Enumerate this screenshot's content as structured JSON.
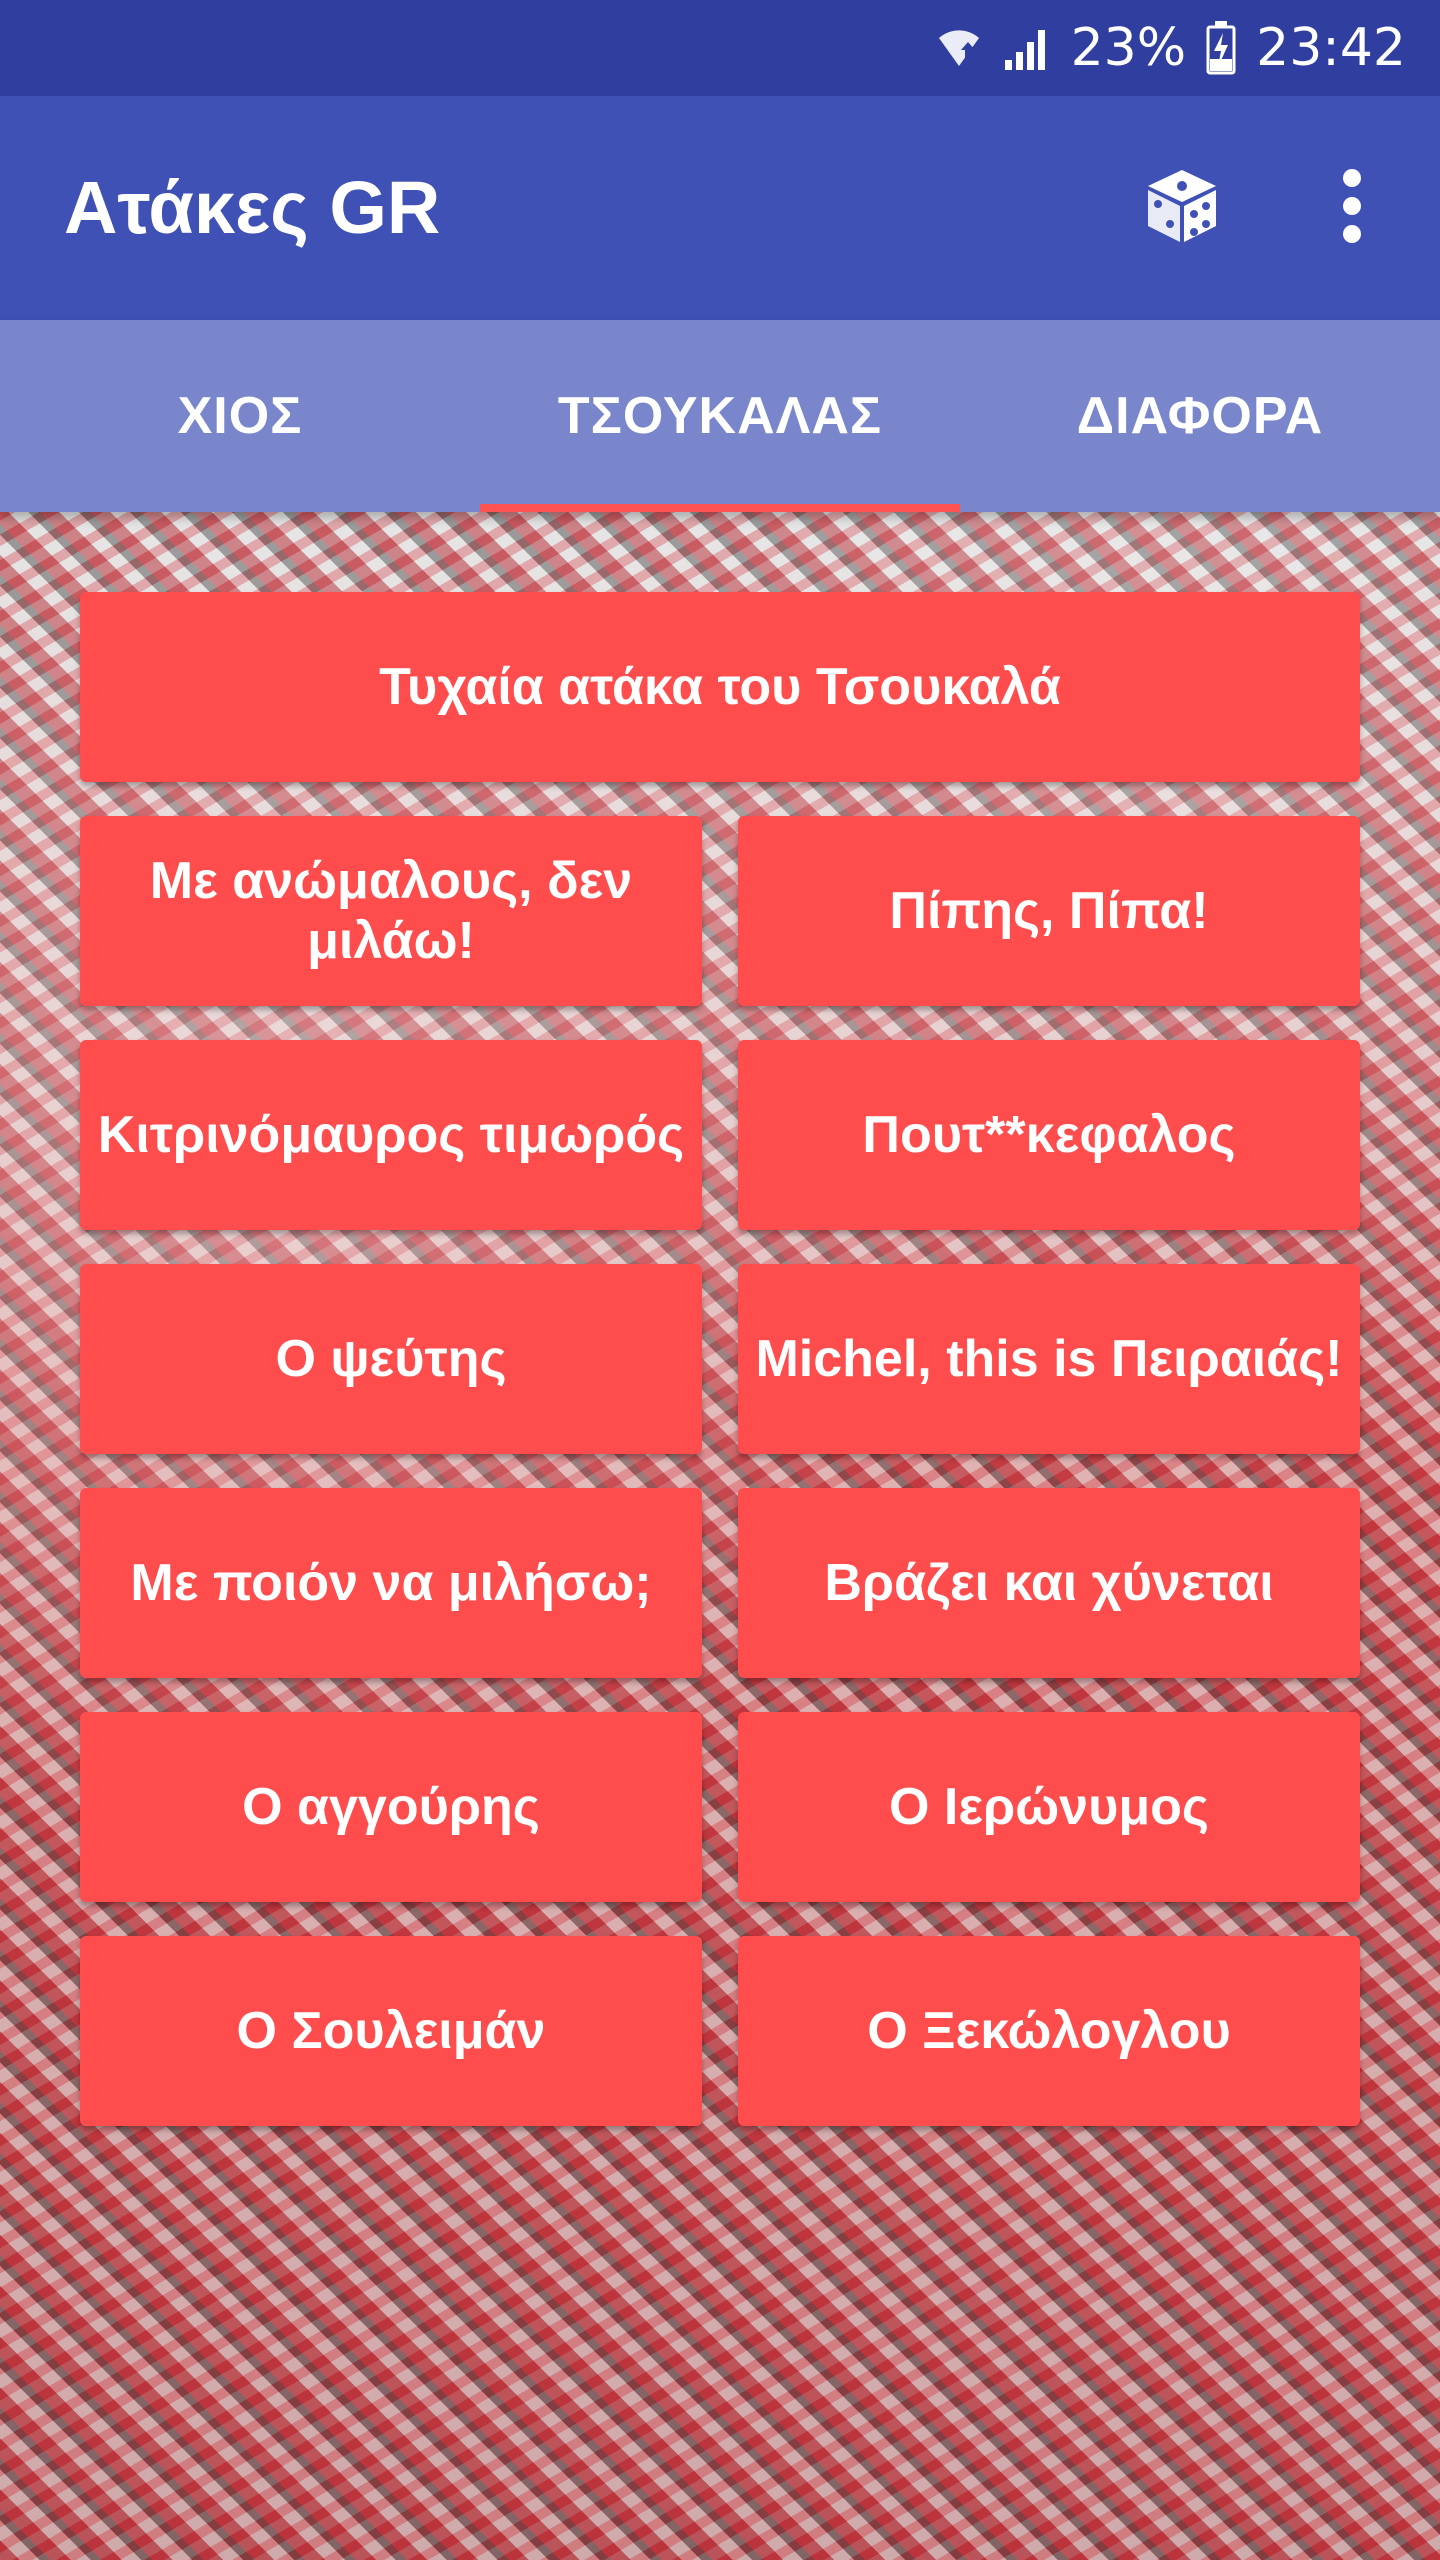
{
  "status_bar": {
    "battery": "23%",
    "time": "23:42"
  },
  "app_bar": {
    "title": "Ατάκες GR",
    "dice_icon": "dice-icon",
    "more_icon": "more-vert-icon"
  },
  "tabs": [
    {
      "label": "ΧΙΟΣ",
      "active": false
    },
    {
      "label": "ΤΣΟΥΚΑΛΑΣ",
      "active": true
    },
    {
      "label": "ΔΙΑΦΟΡΑ",
      "active": false
    }
  ],
  "colors": {
    "status_bar": "#303F9F",
    "app_bar": "#3F51B5",
    "tab_bar": "#7986CB",
    "button": "#FF4C4C",
    "indicator": "#FF5252"
  },
  "random_button": "Τυχαία ατάκα του Τσουκαλά",
  "buttons": [
    "Με ανώμαλους, δεν μιλάω!",
    "Πίπης, Πίπα!",
    "Κιτρινόμαυρος τιμωρός",
    "Πουτ**κεφαλος",
    "Ο ψεύτης",
    "Michel, this is Πειραιάς!",
    "Με ποιόν να μιλήσω;",
    "Βράζει και χύνεται",
    "Ο αγγούρης",
    "Ο Ιερώνυμος",
    "Ο Σουλειμάν",
    "Ο Ξεκώλογλου"
  ]
}
